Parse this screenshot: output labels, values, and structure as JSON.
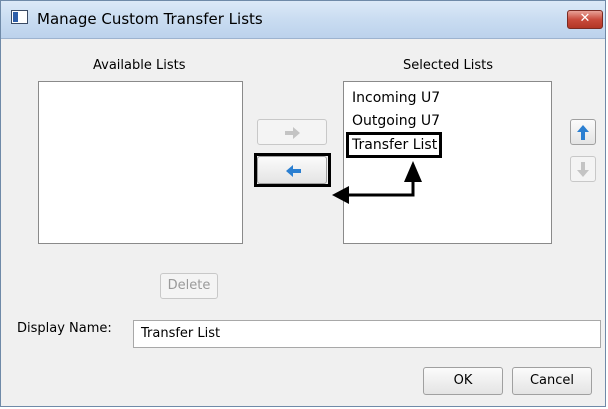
{
  "window": {
    "title": "Manage Custom Transfer Lists",
    "close_glyph": "✕"
  },
  "available": {
    "header": "Available Lists",
    "items": []
  },
  "selected": {
    "header": "Selected Lists",
    "items": [
      "Incoming U7",
      "Outgoing U7",
      "Transfer List"
    ],
    "highlighted_item": "Transfer List"
  },
  "buttons": {
    "delete": "Delete",
    "ok": "OK",
    "cancel": "Cancel"
  },
  "display_name": {
    "label": "Display Name:",
    "value": "Transfer List"
  },
  "icons": {
    "move_right": "arrow-right-icon",
    "move_left": "arrow-left-icon",
    "move_up": "arrow-up-icon",
    "move_down": "arrow-down-icon"
  },
  "colors": {
    "accent_arrow": "#2b7fd1",
    "disabled_arrow": "#c4c4c4",
    "annotation": "#000000"
  }
}
